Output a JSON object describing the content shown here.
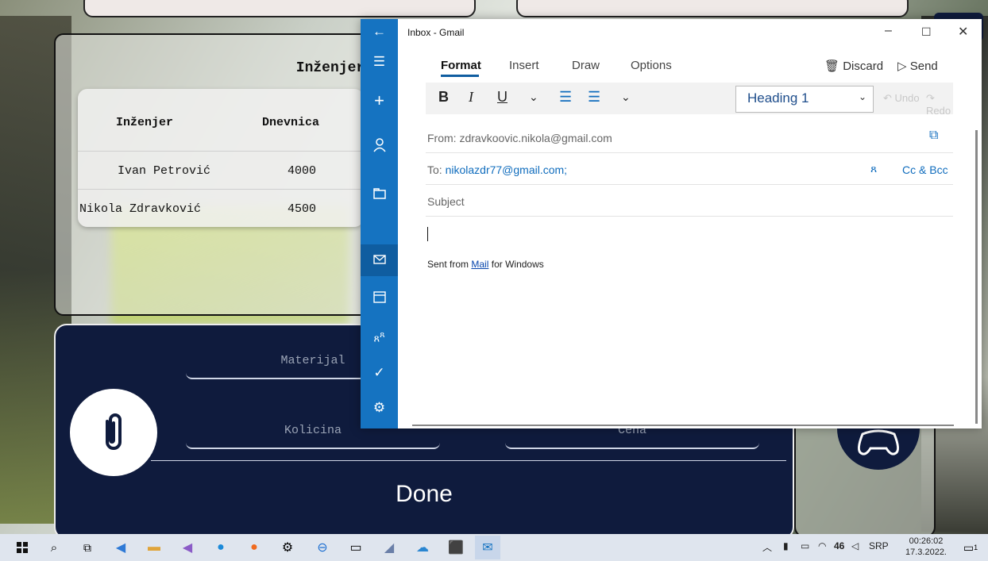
{
  "engineers_card": {
    "title": "Inženjeri",
    "columns": [
      "Inženjer",
      "Dnevnica"
    ],
    "rows": [
      {
        "name": "Ivan Petrović",
        "wage": "4000"
      },
      {
        "name": "Nikola Zdravković",
        "wage": "4500"
      }
    ]
  },
  "form_panel": {
    "material_placeholder": "Materijal",
    "quantity_placeholder": "Kolicina",
    "third_placeholder": "Cena",
    "done_label": "Done"
  },
  "mail": {
    "window_title": "Inbox - Gmail",
    "tabs": [
      "Format",
      "Insert",
      "Draw",
      "Options"
    ],
    "active_tab": "Format",
    "discard_label": "Discard",
    "send_label": "Send",
    "bold": "B",
    "italic": "I",
    "underline": "U",
    "style_value": "Heading 1",
    "undo_label": "Undo",
    "redo_label": "Redo",
    "from_label": "From:",
    "from_value": "zdravkoovic.nikola@gmail.com",
    "to_label": "To:",
    "to_value": "nikolazdr77@gmail.com;",
    "cc_bcc_label": "Cc & Bcc",
    "subject_placeholder": "Subject",
    "signature_prefix": "Sent from",
    "signature_link": "Mail",
    "signature_suffix": "for Windows"
  },
  "taskbar": {
    "temperature": "46",
    "language": "SRP",
    "time": "00:26:02",
    "date": "17.3.2022.",
    "notification_count": "1"
  },
  "colors": {
    "mail_accent": "#1573c1",
    "panel_navy": "#0f1b3d",
    "link_blue": "#0f6cbd"
  }
}
